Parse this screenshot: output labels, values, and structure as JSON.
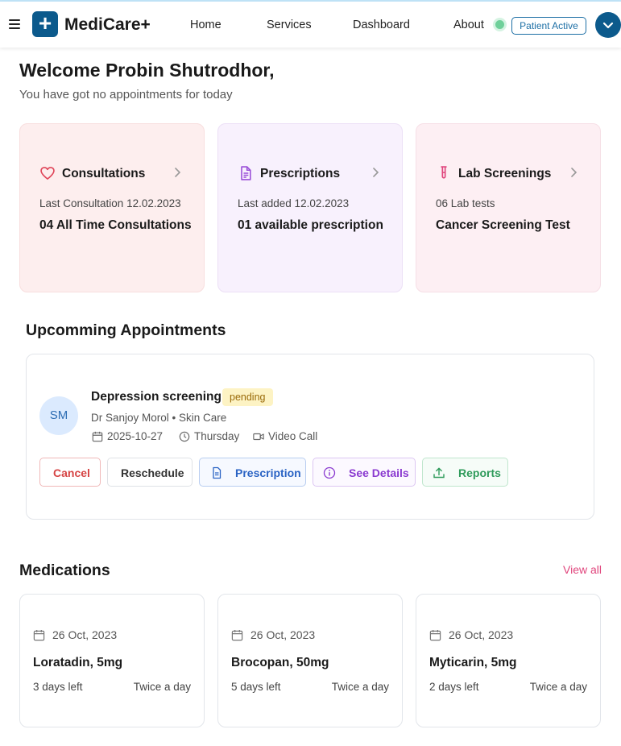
{
  "header": {
    "logo_glyph": "+",
    "app_name": "MediCare+",
    "nav": [
      "Home",
      "Services",
      "Dashboard",
      "About"
    ],
    "status_badge": "Patient Active",
    "status_color": "#6fd09a",
    "brand_color": "#0c5a8c"
  },
  "welcome": {
    "title": "Welcome Probin Shutrodhor,",
    "subtitle": "You have got no appointments for today"
  },
  "summary_cards": [
    {
      "icon": "heart-icon",
      "title": "Consultations",
      "meta": "Last Consultation 12.02.2023",
      "value": "04 All Time Consultations"
    },
    {
      "icon": "document-icon",
      "title": "Prescriptions",
      "meta": "Last added 12.02.2023",
      "value": "01 available prescription"
    },
    {
      "icon": "test-tube-icon",
      "title": "Lab Screenings",
      "meta": "06 Lab tests",
      "value": "Cancer Screening Test"
    }
  ],
  "appointments": {
    "section_title": "Upcomming Appointments",
    "item": {
      "initials": "SM",
      "title": "Depression screening",
      "status": "pending",
      "doctor": "Dr Sanjoy Morol • Skin Care",
      "date": "2025-10-27",
      "day": "Thursday",
      "mode": "Video Call",
      "buttons": {
        "cancel": "Cancel",
        "reschedule": "Reschedule",
        "prescription": "Prescription",
        "details": "See Details",
        "reports": "Reports"
      }
    }
  },
  "medications": {
    "section_title": "Medications",
    "view_all": "View all",
    "items": [
      {
        "date": "26 Oct, 2023",
        "name": "Loratadin, 5mg",
        "days_left": "3 days left",
        "frequency": "Twice a day"
      },
      {
        "date": "26 Oct, 2023",
        "name": "Brocopan, 50mg",
        "days_left": "5 days left",
        "frequency": "Twice a day"
      },
      {
        "date": "26 Oct, 2023",
        "name": "Myticarin, 5mg",
        "days_left": "2 days left",
        "frequency": "Twice a day"
      }
    ]
  }
}
